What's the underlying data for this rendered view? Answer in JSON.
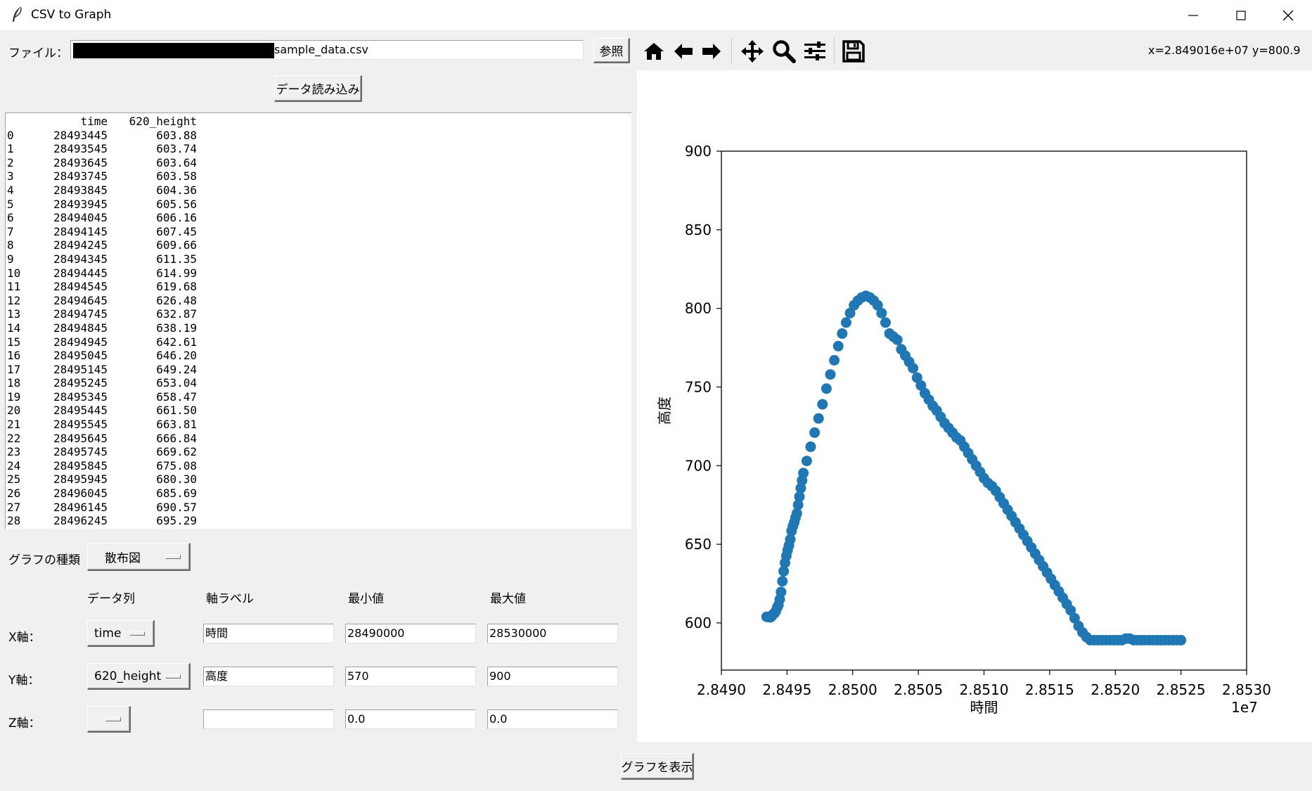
{
  "window": {
    "title": "CSV to Graph",
    "app_icon": "feather-icon"
  },
  "file": {
    "label": "ファイル：",
    "path_value": "sample_data.csv",
    "browse_label": "参照",
    "load_label": "データ読み込み"
  },
  "table": {
    "headers": [
      "",
      "time",
      "620_height"
    ],
    "rows": [
      [
        "0",
        "28493445",
        "603.88"
      ],
      [
        "1",
        "28493545",
        "603.74"
      ],
      [
        "2",
        "28493645",
        "603.64"
      ],
      [
        "3",
        "28493745",
        "603.58"
      ],
      [
        "4",
        "28493845",
        "604.36"
      ],
      [
        "5",
        "28493945",
        "605.56"
      ],
      [
        "6",
        "28494045",
        "606.16"
      ],
      [
        "7",
        "28494145",
        "607.45"
      ],
      [
        "8",
        "28494245",
        "609.66"
      ],
      [
        "9",
        "28494345",
        "611.35"
      ],
      [
        "10",
        "28494445",
        "614.99"
      ],
      [
        "11",
        "28494545",
        "619.68"
      ],
      [
        "12",
        "28494645",
        "626.48"
      ],
      [
        "13",
        "28494745",
        "632.87"
      ],
      [
        "14",
        "28494845",
        "638.19"
      ],
      [
        "15",
        "28494945",
        "642.61"
      ],
      [
        "16",
        "28495045",
        "646.20"
      ],
      [
        "17",
        "28495145",
        "649.24"
      ],
      [
        "18",
        "28495245",
        "653.04"
      ],
      [
        "19",
        "28495345",
        "658.47"
      ],
      [
        "20",
        "28495445",
        "661.50"
      ],
      [
        "21",
        "28495545",
        "663.81"
      ],
      [
        "22",
        "28495645",
        "666.84"
      ],
      [
        "23",
        "28495745",
        "669.62"
      ],
      [
        "24",
        "28495845",
        "675.08"
      ],
      [
        "25",
        "28495945",
        "680.30"
      ],
      [
        "26",
        "28496045",
        "685.69"
      ],
      [
        "27",
        "28496145",
        "690.57"
      ],
      [
        "28",
        "28496245",
        "695.29"
      ]
    ]
  },
  "graph_type": {
    "label": "グラフの種類",
    "value": "散布図"
  },
  "columns": {
    "data_col": "データ列",
    "axis_label": "軸ラベル",
    "min": "最小値",
    "max": "最大値"
  },
  "axes": [
    {
      "label": "X軸：",
      "column": "time",
      "axis_label": "時間",
      "min": "28490000",
      "max": "28530000"
    },
    {
      "label": "Y軸：",
      "column": "620_height",
      "axis_label": "高度",
      "min": "570",
      "max": "900"
    },
    {
      "label": "Z軸：",
      "column": "",
      "axis_label": "",
      "min": "0.0",
      "max": "0.0"
    }
  ],
  "show_graph_label": "グラフを表示",
  "toolbar": {
    "icons": [
      "home-icon",
      "back-icon",
      "forward-icon",
      "pan-icon",
      "zoom-icon",
      "configure-subplots-icon",
      "save-icon"
    ],
    "coords": "x=2.849016e+07 y=800.9"
  },
  "colors": {
    "point": "#1f77b4",
    "bg": "#f0f0f0"
  },
  "chart_data": {
    "type": "scatter",
    "xlabel": "時間",
    "ylabel": "高度",
    "x_offset_label": "1e7",
    "xlim": [
      28490000,
      28530000
    ],
    "ylim": [
      570,
      900
    ],
    "x_ticks": [
      "2.8490",
      "2.8495",
      "2.8500",
      "2.8505",
      "2.8510",
      "2.8515",
      "2.8520",
      "2.8525",
      "2.8530"
    ],
    "y_ticks": [
      "600",
      "650",
      "700",
      "750",
      "800",
      "850",
      "900"
    ],
    "x_tick_values": [
      28490000,
      28495000,
      28500000,
      28505000,
      28510000,
      28515000,
      28520000,
      28525000,
      28530000
    ],
    "y_tick_values": [
      600,
      650,
      700,
      750,
      800,
      850,
      900
    ],
    "points": [
      [
        28493445,
        603.88
      ],
      [
        28493545,
        603.74
      ],
      [
        28493645,
        603.64
      ],
      [
        28493745,
        603.58
      ],
      [
        28493845,
        604.36
      ],
      [
        28493945,
        605.56
      ],
      [
        28494045,
        606.16
      ],
      [
        28494145,
        607.45
      ],
      [
        28494245,
        609.66
      ],
      [
        28494345,
        611.35
      ],
      [
        28494445,
        614.99
      ],
      [
        28494545,
        619.68
      ],
      [
        28494645,
        626.48
      ],
      [
        28494745,
        632.87
      ],
      [
        28494845,
        638.19
      ],
      [
        28494945,
        642.61
      ],
      [
        28495045,
        646.2
      ],
      [
        28495145,
        649.24
      ],
      [
        28495245,
        653.04
      ],
      [
        28495345,
        658.47
      ],
      [
        28495445,
        661.5
      ],
      [
        28495545,
        663.81
      ],
      [
        28495645,
        666.84
      ],
      [
        28495745,
        669.62
      ],
      [
        28495845,
        675.08
      ],
      [
        28495945,
        680.3
      ],
      [
        28496045,
        685.69
      ],
      [
        28496145,
        690.57
      ],
      [
        28496245,
        695.29
      ],
      [
        28496500,
        703
      ],
      [
        28496800,
        712
      ],
      [
        28497100,
        721
      ],
      [
        28497400,
        730
      ],
      [
        28497700,
        739
      ],
      [
        28498000,
        749
      ],
      [
        28498300,
        758
      ],
      [
        28498600,
        767
      ],
      [
        28498900,
        776
      ],
      [
        28499200,
        784
      ],
      [
        28499500,
        791
      ],
      [
        28499800,
        797
      ],
      [
        28500100,
        802
      ],
      [
        28500400,
        805
      ],
      [
        28500700,
        807
      ],
      [
        28501000,
        808
      ],
      [
        28501300,
        807
      ],
      [
        28501600,
        805
      ],
      [
        28501900,
        802
      ],
      [
        28502200,
        797
      ],
      [
        28502500,
        791
      ],
      [
        28502800,
        784
      ],
      [
        28503100,
        782
      ],
      [
        28503400,
        780
      ],
      [
        28503700,
        774
      ],
      [
        28504000,
        770
      ],
      [
        28504300,
        766
      ],
      [
        28504600,
        762
      ],
      [
        28504900,
        756
      ],
      [
        28505200,
        751
      ],
      [
        28505500,
        746
      ],
      [
        28505800,
        742
      ],
      [
        28506100,
        738
      ],
      [
        28506400,
        735
      ],
      [
        28506700,
        731
      ],
      [
        28507000,
        727
      ],
      [
        28507300,
        724
      ],
      [
        28507600,
        721
      ],
      [
        28507900,
        718
      ],
      [
        28508200,
        716
      ],
      [
        28508500,
        712
      ],
      [
        28508800,
        708
      ],
      [
        28509100,
        704
      ],
      [
        28509400,
        700
      ],
      [
        28509700,
        696
      ],
      [
        28510000,
        692
      ],
      [
        28510300,
        689
      ],
      [
        28510600,
        687
      ],
      [
        28510900,
        684
      ],
      [
        28511200,
        680
      ],
      [
        28511500,
        676
      ],
      [
        28511800,
        672
      ],
      [
        28512100,
        668
      ],
      [
        28512400,
        664
      ],
      [
        28512700,
        660
      ],
      [
        28513000,
        656
      ],
      [
        28513300,
        652
      ],
      [
        28513600,
        648
      ],
      [
        28513900,
        644
      ],
      [
        28514200,
        640
      ],
      [
        28514500,
        636
      ],
      [
        28514800,
        632
      ],
      [
        28515100,
        628
      ],
      [
        28515400,
        624
      ],
      [
        28515700,
        620
      ],
      [
        28516000,
        616
      ],
      [
        28516300,
        612
      ],
      [
        28516600,
        608
      ],
      [
        28516900,
        603
      ],
      [
        28517200,
        598
      ],
      [
        28517500,
        594
      ],
      [
        28517800,
        591
      ],
      [
        28518100,
        589
      ],
      [
        28518400,
        589
      ],
      [
        28518700,
        589
      ],
      [
        28519000,
        589
      ],
      [
        28519300,
        589
      ],
      [
        28519600,
        589
      ],
      [
        28519900,
        589
      ],
      [
        28520200,
        589
      ],
      [
        28520500,
        589
      ],
      [
        28520800,
        590
      ],
      [
        28521100,
        590
      ],
      [
        28521400,
        589
      ],
      [
        28521700,
        589
      ],
      [
        28522000,
        589
      ],
      [
        28522300,
        589
      ],
      [
        28522600,
        589
      ],
      [
        28522900,
        589
      ],
      [
        28523200,
        589
      ],
      [
        28523500,
        589
      ],
      [
        28523800,
        589
      ],
      [
        28524100,
        589
      ],
      [
        28524400,
        589
      ],
      [
        28524700,
        589
      ],
      [
        28525000,
        589
      ]
    ]
  }
}
